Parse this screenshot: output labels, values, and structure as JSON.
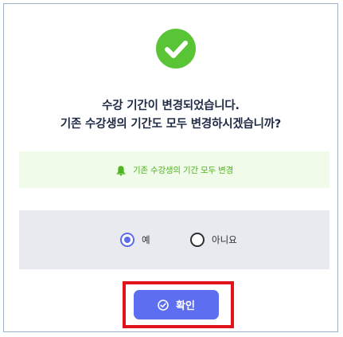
{
  "dialog": {
    "status_icon": "check-circle-icon",
    "message_line1": "수강 기간이 변경되었습니다.",
    "message_line2": "기존 수강생의 기간도 모두 변경하시겠습니까?",
    "notice": {
      "icon": "bell-icon",
      "text": "기존 수강생의 기간 모두 변경"
    },
    "options": [
      {
        "label": "예",
        "selected": true
      },
      {
        "label": "아니요",
        "selected": false
      }
    ],
    "confirm_button": {
      "icon": "check-circle-icon",
      "label": "확인"
    }
  },
  "colors": {
    "success": "#5ac437",
    "notice_text": "#4fb51f",
    "notice_bg": "#f1fbe9",
    "accent": "#5d6ff0",
    "options_bg": "#e9eaef",
    "highlight": "#e0141b"
  }
}
